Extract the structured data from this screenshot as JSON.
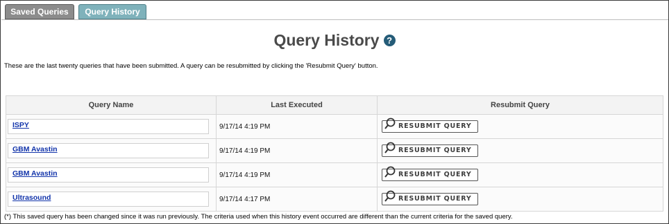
{
  "tabs": {
    "saved": "Saved Queries",
    "history": "Query History"
  },
  "page": {
    "title": "Query History",
    "help_icon": "?",
    "intro": "These are the last twenty queries that have been submitted. A query can be resubmitted by clicking the 'Resubmit Query' button.",
    "footnote": "(*) This saved query has been changed since it was run previously. The criteria used when this history event occurred are different than the current criteria for the saved query."
  },
  "table": {
    "headers": [
      "Query Name",
      "Last Executed",
      "Resubmit Query"
    ],
    "rows": [
      {
        "name": "ISPY",
        "date": "9/17/14 4:19 PM",
        "button": "RESUBMIT QUERY"
      },
      {
        "name": "GBM Avastin",
        "date": "9/17/14 4:19 PM",
        "button": "RESUBMIT QUERY"
      },
      {
        "name": "GBM Avastin",
        "date": "9/17/14 4:19 PM",
        "button": "RESUBMIT QUERY"
      },
      {
        "name": "Ultrasound",
        "date": "9/17/14 4:17 PM",
        "button": "RESUBMIT QUERY"
      }
    ]
  },
  "icons": {
    "help": "help-icon",
    "resubmit": "magnifier-icon"
  },
  "colors": {
    "tab_saved": "#8c8c8c",
    "tab_history": "#7fb2bb",
    "link": "#1133aa",
    "help": "#255c78"
  }
}
